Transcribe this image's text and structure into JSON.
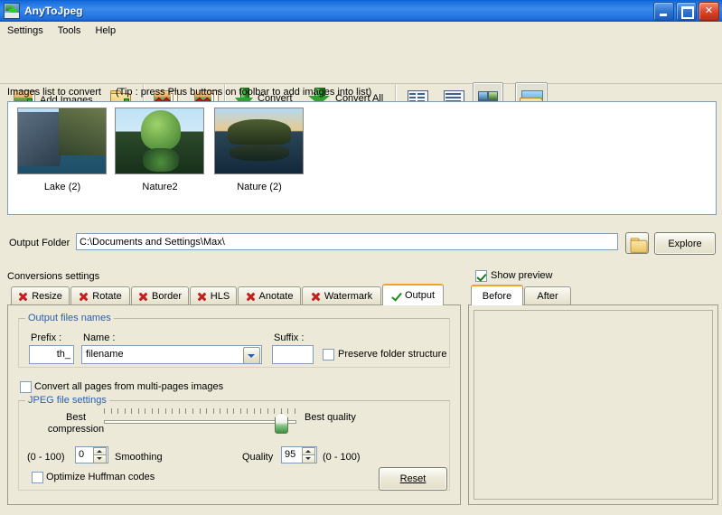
{
  "window": {
    "title": "AnyToJpeg",
    "icon": "app-icon",
    "buttons": {
      "minimize": "minimize",
      "restore": "restore",
      "close": "close"
    }
  },
  "menu": {
    "items": [
      "Settings",
      "Tools",
      "Help"
    ]
  },
  "toolbar": {
    "add_images": "Add Images",
    "add_folder_icon": "folder-plus-icon",
    "remove_image_icon": "remove-image-icon",
    "remove_all_icon": "remove-all-images-icon",
    "convert": "Convert",
    "convert_all": "Convert All",
    "view_list_icon": "view-list-icon",
    "view_details_icon": "view-details-icon",
    "view_thumbnails_icon": "view-thumbnails-icon",
    "open_output_folder_icon": "open-output-folder-icon"
  },
  "images_list": {
    "label": "Images list to convert",
    "tip": "(Tip : press Plus buttons on toolbar to add images into list)",
    "items": [
      {
        "caption": "Lake (2)"
      },
      {
        "caption": "Nature2"
      },
      {
        "caption": "Nature (2)"
      }
    ]
  },
  "output_folder": {
    "label": "Output Folder",
    "value": "C:\\Documents and Settings\\Max\\",
    "browse_icon": "folder-browse-icon",
    "explore_button": "Explore"
  },
  "conversions": {
    "label": "Conversions settings",
    "tabs": [
      {
        "label": "Resize",
        "state": "off",
        "selected": false
      },
      {
        "label": "Rotate",
        "state": "off",
        "selected": false
      },
      {
        "label": "Border",
        "state": "off",
        "selected": false
      },
      {
        "label": "HLS",
        "state": "off",
        "selected": false
      },
      {
        "label": "Anotate",
        "state": "off",
        "selected": false
      },
      {
        "label": "Watermark",
        "state": "off",
        "selected": false
      },
      {
        "label": "Output",
        "state": "on",
        "selected": true
      }
    ]
  },
  "output_tab": {
    "files_names_group": "Output files names",
    "prefix_label": "Prefix :",
    "prefix_value": "th_",
    "name_label": "Name :",
    "name_value": "filename",
    "suffix_label": "Suffix :",
    "suffix_value": "",
    "preserve_folder_structure": "Preserve folder structure",
    "preserve_folder_checked": false,
    "convert_all_pages": "Convert all pages from multi-pages images",
    "convert_all_pages_checked": false,
    "jpeg_group": "JPEG file settings",
    "best_compression_line1": "Best",
    "best_compression_line2": "compression",
    "best_quality": "Best quality",
    "slider_value": 95,
    "slider_min": 0,
    "slider_max": 100,
    "smoothing_range": "(0 - 100)",
    "smoothing_value": "0",
    "smoothing_label": "Smoothing",
    "quality_label": "Quality",
    "quality_value": "95",
    "quality_range": "(0 - 100)",
    "optimize_huffman": "Optimize Huffman codes",
    "optimize_huffman_checked": false,
    "reset_button": "Reset"
  },
  "preview": {
    "show_preview_label": "Show preview",
    "show_preview_checked": true,
    "tabs": [
      {
        "label": "Before",
        "selected": true
      },
      {
        "label": "After",
        "selected": false
      }
    ],
    "content": ""
  },
  "colors": {
    "window_bg": "#ECE9D8",
    "titlebar_blue": "#1D6EDB",
    "accent_orange": "#F0A32A",
    "group_caption_blue": "#2B5FAD",
    "tab_x_red": "#C81E1E",
    "tab_check_green": "#189018"
  }
}
